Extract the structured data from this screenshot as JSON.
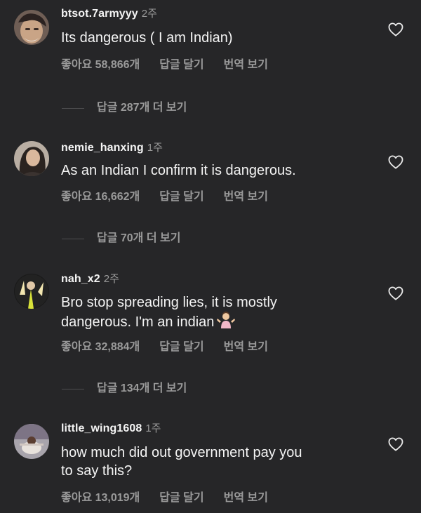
{
  "colors": {
    "background": "#262628",
    "primary_text": "#f4f4f4",
    "secondary_text": "#9a9a9a",
    "divider": "#4d4d4f"
  },
  "comments": [
    {
      "username": "btsot.7armyyy",
      "ago": "2주",
      "text_lines": [
        "Its dangerous ( I am Indian)"
      ],
      "likes_label": "좋아요 58,866개",
      "reply_label": "답글 달기",
      "translate_label": "번역 보기",
      "view_replies_label": "답글 287개 더 보기",
      "heart_icon": "heart-outline-icon"
    },
    {
      "username": "nemie_hanxing",
      "ago": "1주",
      "text_lines": [
        "As an Indian I confirm it is dangerous."
      ],
      "likes_label": "좋아요 16,662개",
      "reply_label": "답글 달기",
      "translate_label": "번역 보기",
      "view_replies_label": "답글 70개 더 보기",
      "heart_icon": "heart-outline-icon"
    },
    {
      "username": "nah_x2",
      "ago": "2주",
      "text_lines": [
        "Bro stop spreading lies, it is mostly",
        "dangerous. I'm an indian"
      ],
      "emoji": "person-shrugging-emoji",
      "likes_label": "좋아요 32,884개",
      "reply_label": "답글 달기",
      "translate_label": "번역 보기",
      "view_replies_label": "답글 134개 더 보기",
      "heart_icon": "heart-outline-icon"
    },
    {
      "username": "little_wing1608",
      "ago": "1주",
      "text_lines": [
        "how much did out government pay you",
        "to say this?"
      ],
      "likes_label": "좋아요 13,019개",
      "reply_label": "답글 달기",
      "translate_label": "번역 보기",
      "heart_icon": "heart-outline-icon"
    }
  ]
}
